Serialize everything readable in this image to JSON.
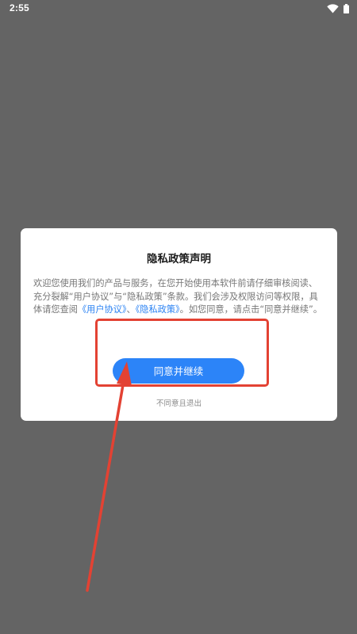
{
  "status_bar": {
    "time": "2:55",
    "icons": [
      "wifi-icon",
      "battery-icon"
    ]
  },
  "dialog": {
    "title": "隐私政策声明",
    "body": {
      "text_1": "欢迎您使用我们的产品与服务，在您开始使用本软件前请仔细审核阅读、充分裂解“用户协议”与“隐私政策”条款。我们会涉及权限访问等权限，具体请您查阅",
      "link_user_agreement": "《用户协议》",
      "separator": "、",
      "link_privacy_policy": "《隐私政策》",
      "text_2": "。如您同意，请点击“同意并继续”。"
    },
    "agree_button_label": "同意并继续",
    "decline_label": "不同意且退出"
  },
  "colors": {
    "backdrop": "#646464",
    "dialog_bg": "#ffffff",
    "accent": "#2c84f8",
    "link": "#2a82f3",
    "annotation": "#e34233"
  }
}
